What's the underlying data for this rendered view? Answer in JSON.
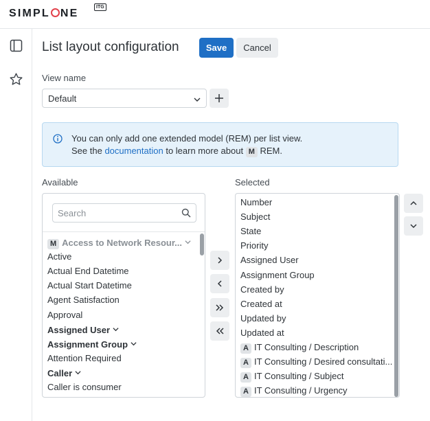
{
  "brand": {
    "logo_pre": "SIMPL",
    "logo_post": "NE",
    "badge": "ITG"
  },
  "nav": {
    "icons": [
      "sidebar-toggle-icon",
      "star-icon"
    ]
  },
  "header": {
    "title": "List layout configuration",
    "save_label": "Save",
    "cancel_label": "Cancel"
  },
  "view": {
    "label": "View name",
    "selected": "Default"
  },
  "info": {
    "line1": "You can only add one extended model (REM) per list view.",
    "line2_pre": "See the ",
    "link": "documentation",
    "line2_mid": " to learn more about ",
    "badge": "M",
    "line2_post": " REM."
  },
  "available": {
    "label": "Available",
    "search_placeholder": "Search",
    "items": [
      {
        "badge": "M",
        "text": "Access to Network Resour...",
        "style": "greyed",
        "expand": true
      },
      {
        "text": "Active",
        "style": "normal"
      },
      {
        "text": "Actual End Datetime",
        "style": "normal"
      },
      {
        "text": "Actual Start Datetime",
        "style": "normal"
      },
      {
        "text": "Agent Satisfaction",
        "style": "normal"
      },
      {
        "text": "Approval",
        "style": "normal"
      },
      {
        "text": "Assigned User",
        "style": "bold",
        "expand": true
      },
      {
        "text": "Assignment Group",
        "style": "bold",
        "expand": true
      },
      {
        "text": "Attention Required",
        "style": "normal"
      },
      {
        "text": "Caller",
        "style": "bold",
        "expand": true
      },
      {
        "text": "Caller is consumer",
        "style": "normal"
      }
    ]
  },
  "selected": {
    "label": "Selected",
    "items": [
      {
        "text": "Number"
      },
      {
        "text": "Subject"
      },
      {
        "text": "State"
      },
      {
        "text": "Priority"
      },
      {
        "text": "Assigned User"
      },
      {
        "text": "Assignment Group"
      },
      {
        "text": "Created by"
      },
      {
        "text": "Created at"
      },
      {
        "text": "Updated by"
      },
      {
        "text": "Updated at"
      },
      {
        "badge": "A",
        "text": "IT Consulting / Description"
      },
      {
        "badge": "A",
        "text": "IT Consulting / Desired consultati..."
      },
      {
        "badge": "A",
        "text": "IT Consulting / Subject"
      },
      {
        "badge": "A",
        "text": "IT Consulting / Urgency"
      }
    ]
  },
  "transfer_buttons": [
    "move-right-icon",
    "move-left-icon",
    "move-all-right-icon",
    "move-all-left-icon"
  ],
  "order_buttons": [
    "move-up-icon",
    "move-down-icon"
  ],
  "colors": {
    "primary": "#1f6fc5",
    "brand_red": "#e2414b",
    "info_bg": "#e6f2fb",
    "info_border": "#b7d8f0"
  }
}
